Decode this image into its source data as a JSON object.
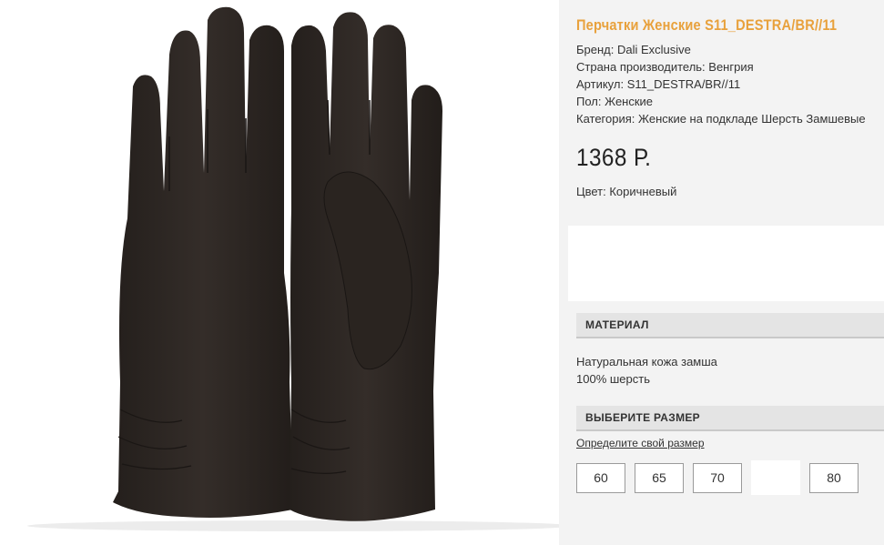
{
  "product": {
    "title": "Перчатки Женские S11_DESTRA/BR//11",
    "image_icon": "suede-gloves-photo",
    "specs": [
      "Бренд: Dali Exclusive",
      "Страна производитель: Венгрия",
      "Артикул: S11_DESTRA/BR//11",
      "Пол: Женские",
      "Категория: Женские на подкладе Шерсть Замшевые"
    ],
    "price": "1368 Р.",
    "color": "Цвет: Коричневый"
  },
  "material": {
    "header": "МАТЕРИАЛ",
    "lines": [
      "Натуральная кожа замша",
      "100% шерсть"
    ]
  },
  "size": {
    "header": "ВЫБЕРИТЕ РАЗМЕР",
    "link": "Определите свой размер",
    "options": [
      "60",
      "65",
      "70",
      "",
      "80"
    ]
  },
  "colors": {
    "title": "#e8a13c",
    "panel": "#f3f3f3",
    "header_bg": "#e4e4e4",
    "glove": "#2e2824"
  }
}
